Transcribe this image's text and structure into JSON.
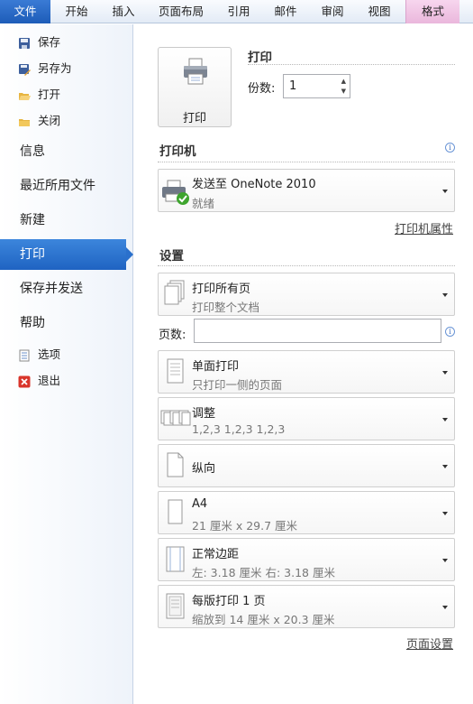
{
  "tabs": [
    "文件",
    "开始",
    "插入",
    "页面布局",
    "引用",
    "邮件",
    "审阅",
    "视图",
    "格式"
  ],
  "sidebar": {
    "small_items": [
      {
        "label": "保存",
        "icon": "save-icon"
      },
      {
        "label": "另存为",
        "icon": "save-as-icon"
      },
      {
        "label": "打开",
        "icon": "open-folder-icon"
      },
      {
        "label": "关闭",
        "icon": "close-folder-icon"
      }
    ],
    "big_items": [
      "信息",
      "最近所用文件",
      "新建",
      "打印",
      "保存并发送",
      "帮助"
    ],
    "bottom_items": [
      {
        "label": "选项",
        "icon": "options-icon"
      },
      {
        "label": "退出",
        "icon": "exit-icon"
      }
    ]
  },
  "print": {
    "title": "打印",
    "button_label": "打印",
    "copies_label": "份数:",
    "copies_value": "1"
  },
  "printer": {
    "header": "打印机",
    "name": "发送至 OneNote 2010",
    "status": "就绪",
    "properties_link": "打印机属性"
  },
  "settings": {
    "header": "设置",
    "pages_label": "页数:",
    "pages_value": "",
    "page_setup_link": "页面设置",
    "options": [
      {
        "title": "打印所有页",
        "subtitle": "打印整个文档"
      },
      {
        "title": "单面打印",
        "subtitle": "只打印一侧的页面"
      },
      {
        "title": "调整",
        "subtitle": "1,2,3    1,2,3    1,2,3"
      },
      {
        "title": "纵向",
        "subtitle": ""
      },
      {
        "title": "A4",
        "subtitle": "21 厘米 x 29.7 厘米"
      },
      {
        "title": "正常边距",
        "subtitle": "左: 3.18 厘米    右: 3.18 厘米"
      },
      {
        "title": "每版打印 1 页",
        "subtitle": "缩放到 14 厘米 x 20.3 厘米"
      }
    ]
  },
  "colors": {
    "file_tab": "#1d5cb8",
    "active_item": "#2a70cc",
    "format_tab": "#eab7dc"
  }
}
